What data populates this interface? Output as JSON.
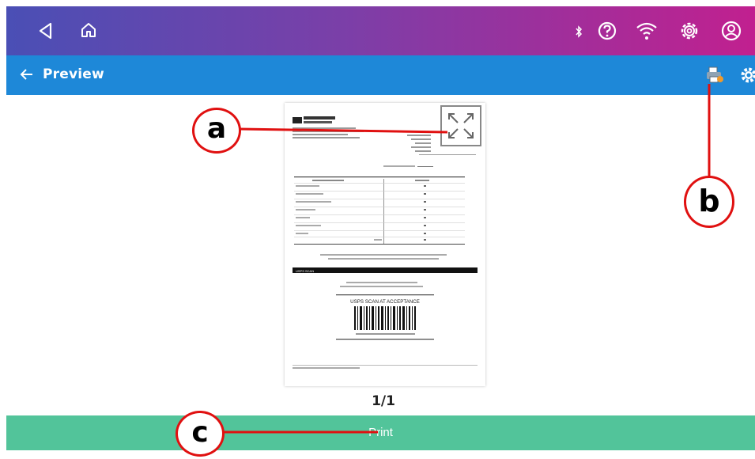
{
  "app_bar": {
    "title": "Preview"
  },
  "pager": {
    "text": "1/1"
  },
  "print_bar": {
    "label": "Print"
  },
  "callouts": {
    "a": "a",
    "b": "b",
    "c": "c"
  },
  "document": {
    "section_label": "USPS SCAN",
    "acceptance_label": "USPS SCAN AT ACCEPTANCE"
  },
  "colors": {
    "status_bar_start": "#4a4fb5",
    "status_bar_end": "#c1208f",
    "app_bar": "#1e88d8",
    "print_bar": "#52c49a",
    "callout": "#e01010"
  },
  "icons": [
    "back-triangle-icon",
    "home-icon",
    "bluetooth-icon",
    "help-icon",
    "wifi-icon",
    "settings-icon",
    "account-icon",
    "arrow-left-icon",
    "print-setting-icon",
    "gear-icon",
    "expand-icon"
  ]
}
